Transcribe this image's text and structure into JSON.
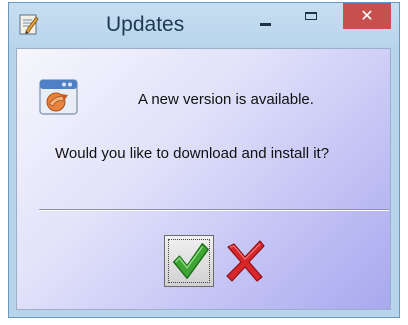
{
  "window": {
    "title": "Updates",
    "close_glyph": "✕",
    "app_icon": "notepad-pencil-icon",
    "controls": [
      "minimize-icon",
      "maximize-icon",
      "close-icon"
    ]
  },
  "dialog": {
    "icon": "update-window-icon",
    "message_line_1": "A new version is available.",
    "message_line_2": "Would you like to download and install it?",
    "accept_icon": "green-checkmark-icon",
    "decline_icon": "red-x-icon"
  },
  "colors": {
    "titlebar": "#b9d5ec",
    "close_button": "#c7504f",
    "accept": "#3fa534",
    "decline": "#d8262b"
  }
}
